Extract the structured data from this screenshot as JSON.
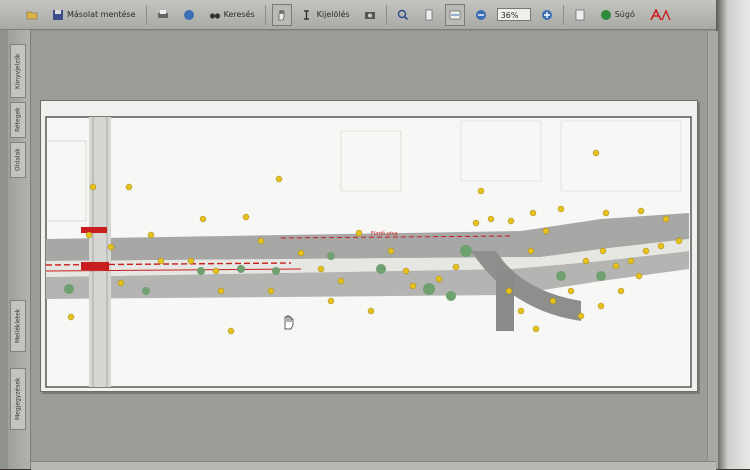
{
  "toolbar": {
    "copy_measure_label": "Másolat mentése",
    "search_label": "Keresés",
    "select_label": "Kijelölés",
    "zoom_value": "36%",
    "help_label": "Súgó"
  },
  "sidebar": {
    "tabs": [
      "Könyvjelzők",
      "Rétegek",
      "Oldalak",
      "Mellékletek",
      "Megjegyzések"
    ]
  },
  "drawing": {
    "road_label_top": "Fürdő utca"
  },
  "colors": {
    "accent_red": "#c81e1e",
    "marker_yellow": "#e8c21c",
    "road_gray": "#9a9a98"
  }
}
